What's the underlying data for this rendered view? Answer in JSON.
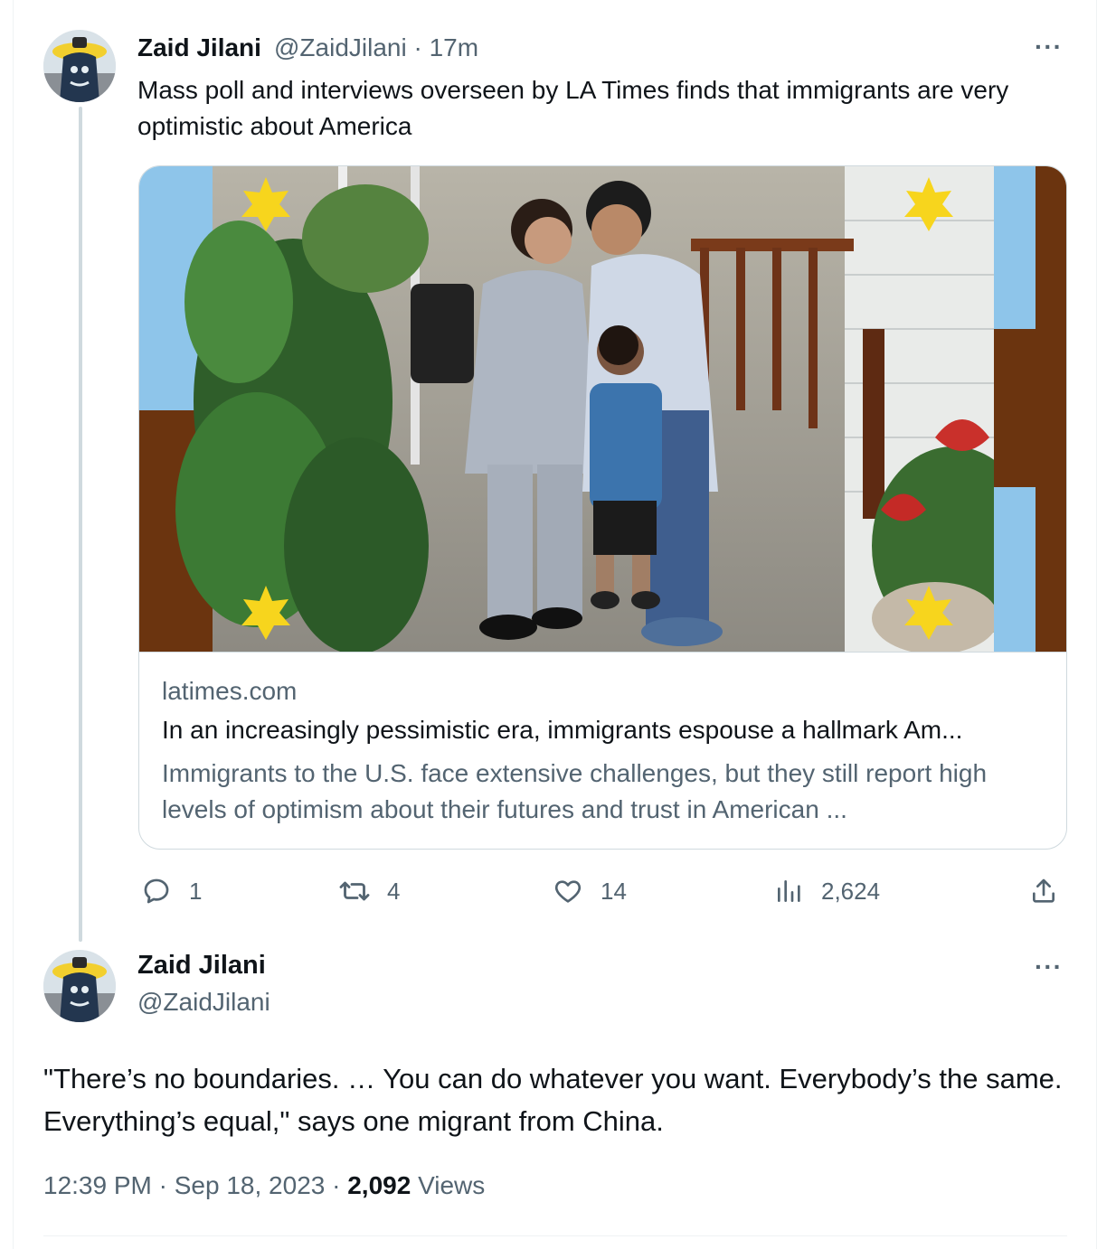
{
  "first_tweet": {
    "display_name": "Zaid Jilani",
    "handle": "@ZaidJilani",
    "separator": "·",
    "time_ago": "17m",
    "text": "Mass poll and interviews overseen by LA Times finds that immigrants are very optimistic about America",
    "more_label": "···",
    "card": {
      "domain": "latimes.com",
      "title": "In an increasingly pessimistic era, immigrants espouse a hallmark Am...",
      "description": "Immigrants to the U.S. face extensive challenges, but they still report high levels of optimism about their futures and trust in American ..."
    },
    "actions": {
      "replies": "1",
      "retweets": "4",
      "likes": "14",
      "views": "2,624"
    }
  },
  "second_tweet": {
    "display_name": "Zaid Jilani",
    "handle": "@ZaidJilani",
    "more_label": "···",
    "text": "\"There’s no boundaries. … You can do whatever you want. Everybody’s the same. Everything’s equal,\" says one migrant from China.",
    "time": "12:39 PM",
    "separator": "·",
    "date": "Sep 18, 2023",
    "views_count": "2,092",
    "views_label": "Views"
  },
  "colors": {
    "text_primary": "#0f1419",
    "text_secondary": "#536471",
    "border": "#cfd9de",
    "card_sky_blue": "#8ec5ea",
    "card_brown": "#6b340f",
    "card_star": "#f7d51d"
  },
  "icons": [
    "reply-icon",
    "retweet-icon",
    "like-icon",
    "views-icon",
    "share-icon",
    "more-icon"
  ]
}
